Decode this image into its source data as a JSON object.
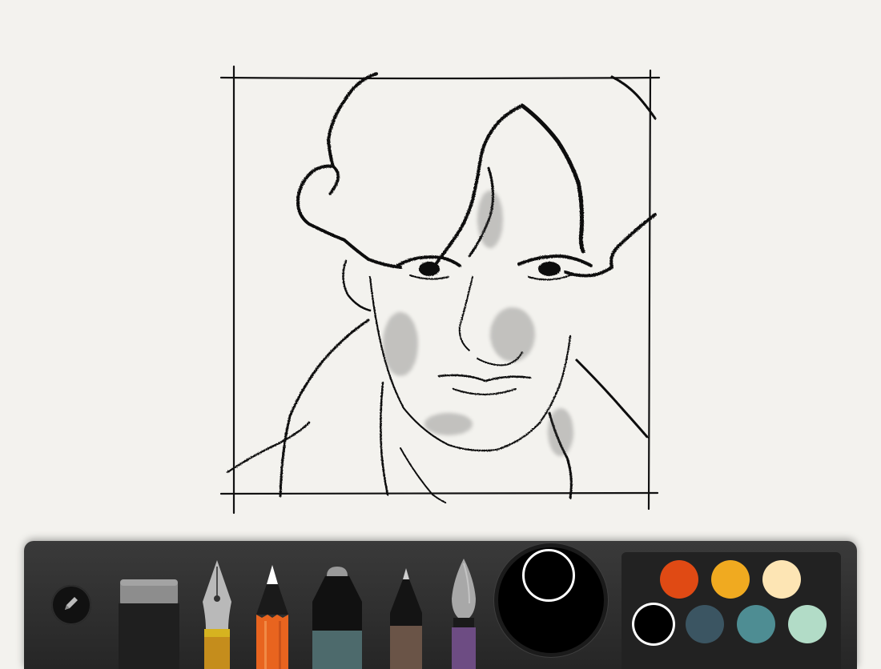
{
  "tools": {
    "names": [
      "eraser",
      "fountain-pen",
      "pencil",
      "marker",
      "fine-pen",
      "brush"
    ],
    "selected": "pencil"
  },
  "colors": {
    "palette": [
      "#e04a14",
      "#f0aa20",
      "#fde5b4",
      "#000000",
      "#3b5562",
      "#4e8d93",
      "#b2dcc7"
    ],
    "selected": "#000000"
  },
  "icons": {
    "menu": "pencil-icon"
  }
}
